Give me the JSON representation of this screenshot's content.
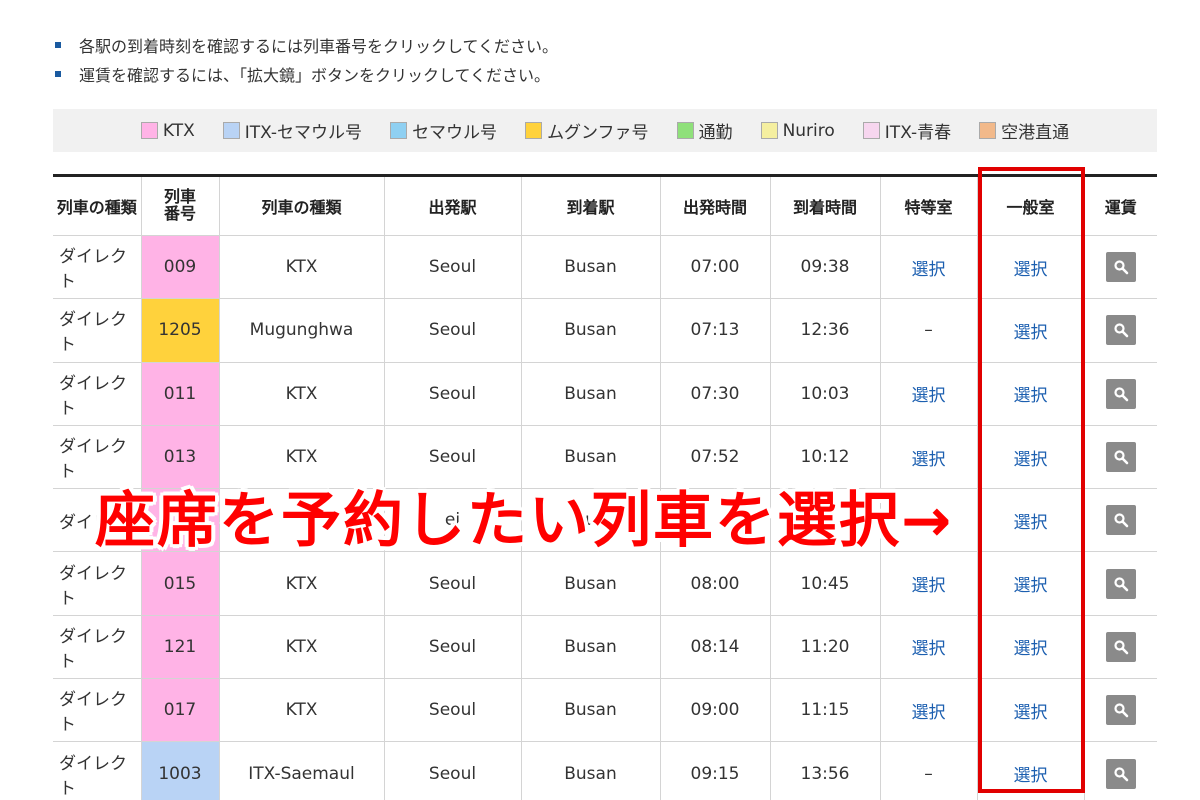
{
  "notes": [
    "各駅の到着時刻を確認するには列車番号をクリックしてください。",
    "運賃を確認するには、「拡大鏡」ボタンをクリックしてください。"
  ],
  "legend": [
    {
      "label": "KTX",
      "color": "#ffb3e6"
    },
    {
      "label": "ITX-セマウル号",
      "color": "#b9d3f5"
    },
    {
      "label": "セマウル号",
      "color": "#8fd0f2"
    },
    {
      "label": "ムグンファ号",
      "color": "#ffd23c"
    },
    {
      "label": "通勤",
      "color": "#8fe07a"
    },
    {
      "label": "Nuriro",
      "color": "#f5efa0"
    },
    {
      "label": "ITX-青春",
      "color": "#f7d6ef"
    },
    {
      "label": "空港直通",
      "color": "#f2b98a"
    }
  ],
  "headers": {
    "service_type": "列車の種類",
    "train_number_line1": "列車",
    "train_number_line2": "番号",
    "train_type": "列車の種類",
    "departure_station": "出発駅",
    "arrival_station": "到着駅",
    "departure_time": "出発時間",
    "arrival_time": "到着時間",
    "first_class": "特等室",
    "general": "一般室",
    "fare": "運賃"
  },
  "rows": [
    {
      "service": "ダイレクト",
      "number": "009",
      "color": "#ffb3e6",
      "train": "KTX",
      "from": "Seoul",
      "to": "Busan",
      "dep": "07:00",
      "arr": "09:38",
      "first": "選択",
      "general": "選択"
    },
    {
      "service": "ダイレクト",
      "number": "1205",
      "color": "#ffd23c",
      "train": "Mugunghwa",
      "from": "Seoul",
      "to": "Busan",
      "dep": "07:13",
      "arr": "12:36",
      "first": "–",
      "general": "選択"
    },
    {
      "service": "ダイレクト",
      "number": "011",
      "color": "#ffb3e6",
      "train": "KTX",
      "from": "Seoul",
      "to": "Busan",
      "dep": "07:30",
      "arr": "10:03",
      "first": "選択",
      "general": "選択"
    },
    {
      "service": "ダイレクト",
      "number": "013",
      "color": "#ffb3e6",
      "train": "KTX",
      "from": "Seoul",
      "to": "Busan",
      "dep": "07:52",
      "arr": "10:12",
      "first": "選択",
      "general": "選択"
    },
    {
      "service": "ダイレ",
      "number": "",
      "color": "#ffb3e6",
      "train": "",
      "from": "ei",
      "to": "u",
      "dep": "",
      "arr": "",
      "first": "",
      "general": "選択"
    },
    {
      "service": "ダイレクト",
      "number": "015",
      "color": "#ffb3e6",
      "train": "KTX",
      "from": "Seoul",
      "to": "Busan",
      "dep": "08:00",
      "arr": "10:45",
      "first": "選択",
      "general": "選択"
    },
    {
      "service": "ダイレクト",
      "number": "121",
      "color": "#ffb3e6",
      "train": "KTX",
      "from": "Seoul",
      "to": "Busan",
      "dep": "08:14",
      "arr": "11:20",
      "first": "選択",
      "general": "選択"
    },
    {
      "service": "ダイレクト",
      "number": "017",
      "color": "#ffb3e6",
      "train": "KTX",
      "from": "Seoul",
      "to": "Busan",
      "dep": "09:00",
      "arr": "11:15",
      "first": "選択",
      "general": "選択"
    },
    {
      "service": "ダイレクト",
      "number": "1003",
      "color": "#b9d3f5",
      "train": "ITX-Saemaul",
      "from": "Seoul",
      "to": "Busan",
      "dep": "09:15",
      "arr": "13:56",
      "first": "–",
      "general": "選択"
    }
  ],
  "annotation": "座席を予約したい列車を選択→",
  "colors": {
    "link": "#1c5fb0",
    "highlight": "#e10000",
    "annotation": "#ff0000"
  }
}
